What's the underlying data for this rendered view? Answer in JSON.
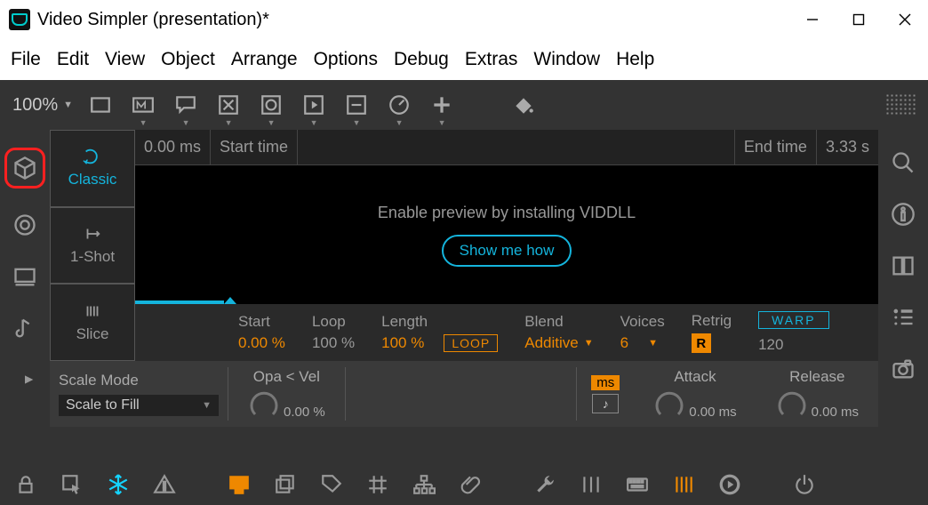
{
  "title": "Video Simpler (presentation)*",
  "menu": [
    "File",
    "Edit",
    "View",
    "Object",
    "Arrange",
    "Options",
    "Debug",
    "Extras",
    "Window",
    "Help"
  ],
  "zoom": "100%",
  "modes": {
    "classic": "Classic",
    "oneshot": "1-Shot",
    "slice": "Slice"
  },
  "time": {
    "start_val": "0.00 ms",
    "start_label": "Start time",
    "end_label": "End time",
    "end_val": "3.33 s"
  },
  "preview": {
    "msg": "Enable preview by installing VIDDLL",
    "show_btn": "Show me how"
  },
  "params": {
    "start": {
      "lbl": "Start",
      "val": "0.00 %"
    },
    "loop": {
      "lbl": "Loop",
      "val": "100 %"
    },
    "length": {
      "lbl": "Length",
      "val": "100 %",
      "pill": "LOOP"
    },
    "blend": {
      "lbl": "Blend",
      "val": "Additive"
    },
    "voices": {
      "lbl": "Voices",
      "val": "6"
    },
    "retrig": {
      "lbl": "Retrig",
      "val": "R"
    },
    "warp": {
      "pill": "WARP",
      "val": "120"
    }
  },
  "knobs": {
    "scale_mode_lbl": "Scale Mode",
    "scale_mode_val": "Scale to Fill",
    "opa": {
      "lbl": "Opa < Vel",
      "val": "0.00 %"
    },
    "ms_badge": "ms",
    "note_badge": "♪",
    "attack": {
      "lbl": "Attack",
      "val": "0.00 ms"
    },
    "release": {
      "lbl": "Release",
      "val": "0.00 ms"
    }
  }
}
